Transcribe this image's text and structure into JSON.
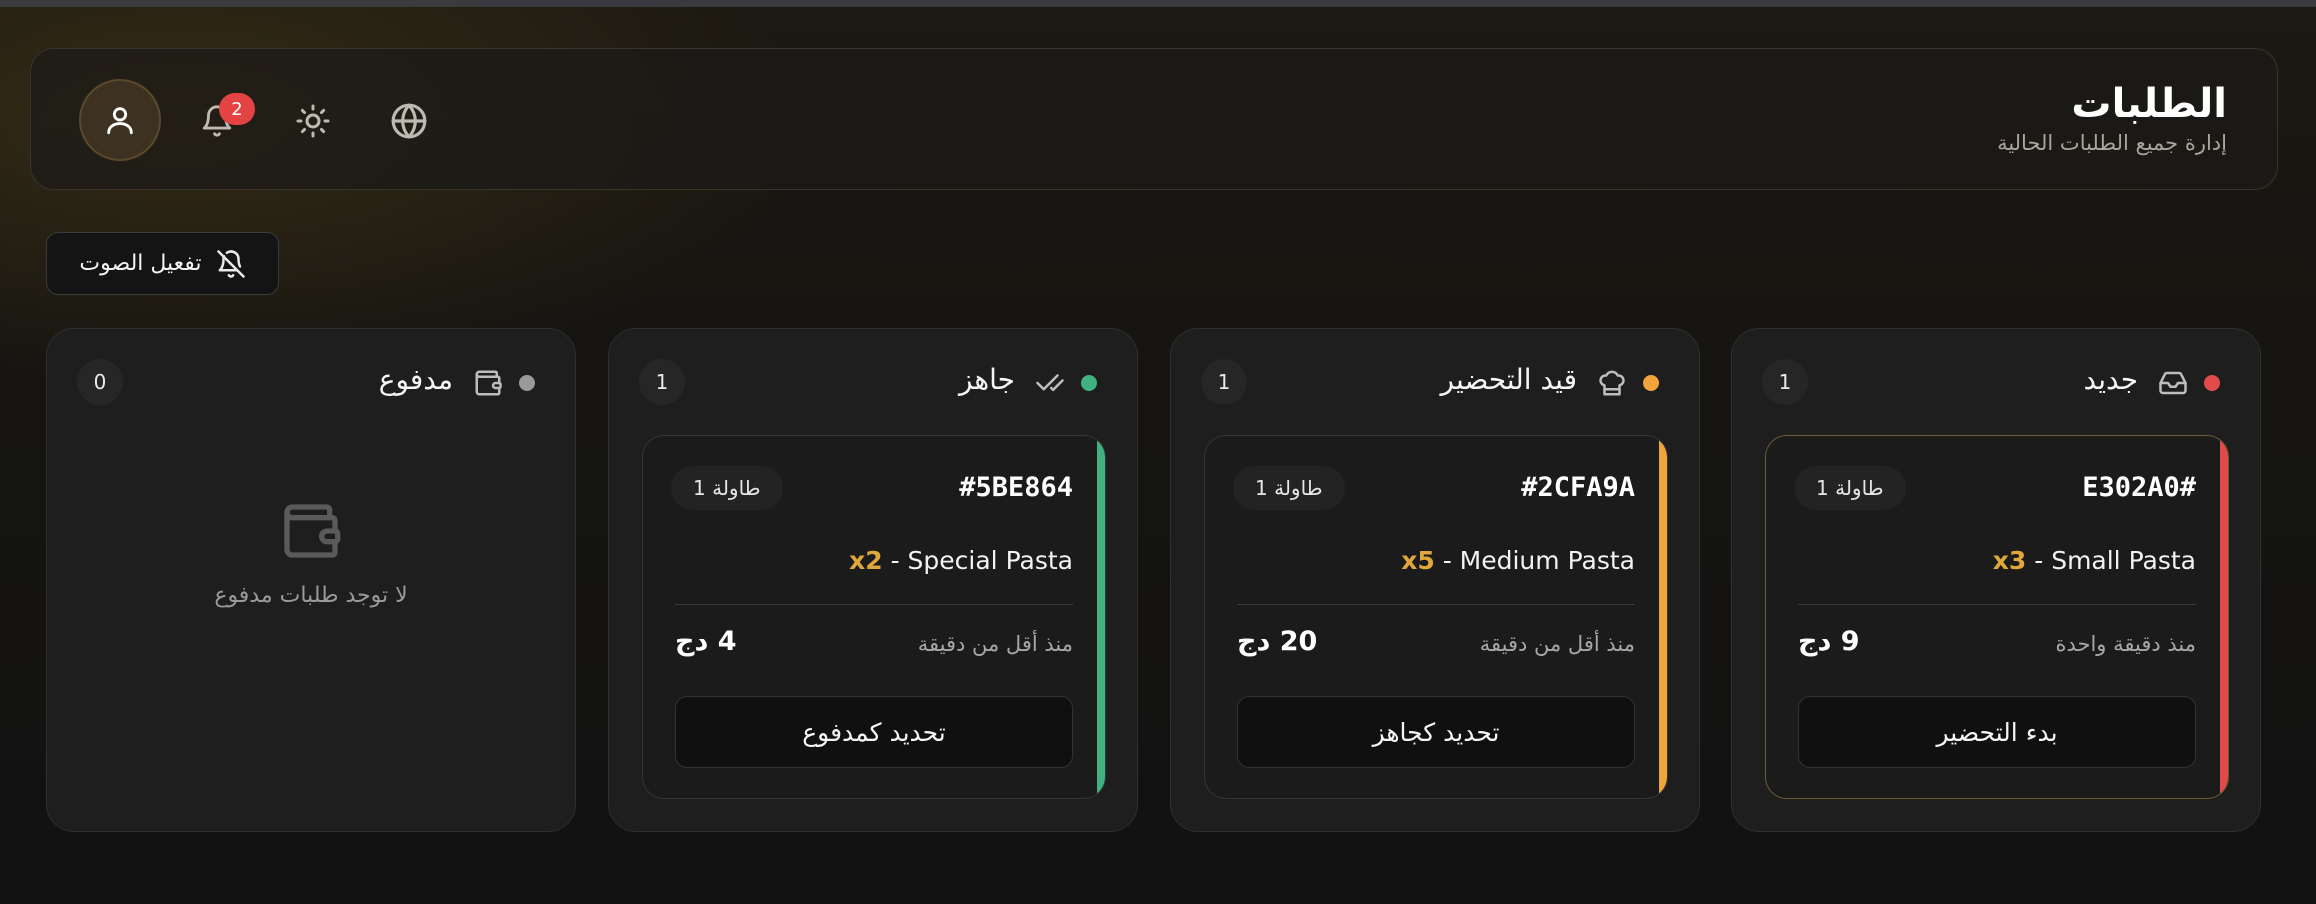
{
  "header": {
    "title": "الطلبات",
    "subtitle": "إدارة جميع الطلبات الحالية",
    "notification_count": "2",
    "icons": [
      "user-icon",
      "bell-icon",
      "sun-icon",
      "globe-icon"
    ]
  },
  "sound_button": {
    "label": "تفعيل الصوت",
    "icon": "bell-off-icon"
  },
  "colors": {
    "new": "#e14b4b",
    "preparing": "#f0a43a",
    "ready": "#3fb27f",
    "paid": "#9a9a9a",
    "accent_qty": "#e0a83a"
  },
  "columns": {
    "new": {
      "title": "جديد",
      "count": "1",
      "icon": "inbox-icon",
      "order": {
        "id": "E302A0#",
        "table": "طاولة 1",
        "qty": "x3",
        "item": " - Small Pasta",
        "elapsed": "منذ دقيقة واحدة",
        "price": "9 دج",
        "action": "بدء التحضير"
      }
    },
    "preparing": {
      "title": "قيد التحضير",
      "count": "1",
      "icon": "chef-hat-icon",
      "order": {
        "id": "#2CFA9A",
        "table": "طاولة 1",
        "qty": "x5",
        "item": " - Medium Pasta",
        "elapsed": "منذ أقل من دقيقة",
        "price": "20 دج",
        "action": "تحديد كجاهز"
      }
    },
    "ready": {
      "title": "جاهز",
      "count": "1",
      "icon": "check-check-icon",
      "order": {
        "id": "#5BE864",
        "table": "طاولة 1",
        "qty": "x2",
        "item": " - Special Pasta",
        "elapsed": "منذ أقل من دقيقة",
        "price": "4 دج",
        "action": "تحديد كمدفوع"
      }
    },
    "paid": {
      "title": "مدفوع",
      "count": "0",
      "icon": "wallet-icon",
      "empty_text": "لا توجد طلبات مدفوع"
    }
  }
}
